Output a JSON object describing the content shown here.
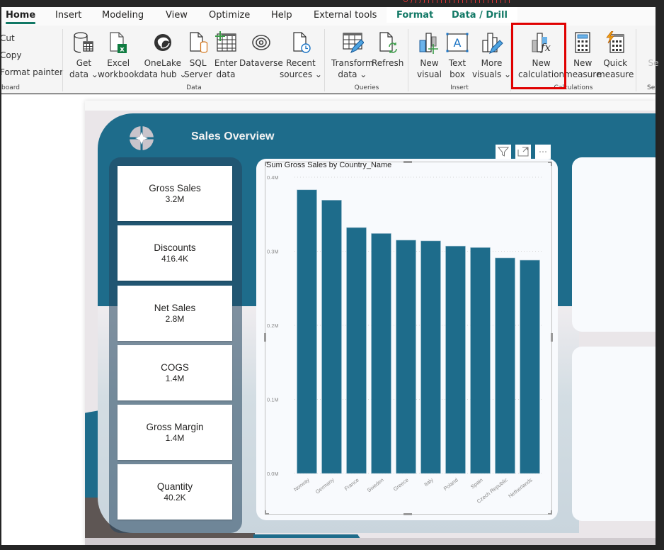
{
  "ribbon": {
    "tabs": [
      {
        "label": "Home",
        "active": true
      },
      {
        "label": "Insert"
      },
      {
        "label": "Modeling"
      },
      {
        "label": "View"
      },
      {
        "label": "Optimize"
      },
      {
        "label": "Help"
      },
      {
        "label": "External tools"
      },
      {
        "label": "Format",
        "contextual": true
      },
      {
        "label": "Data / Drill",
        "contextual": true
      }
    ],
    "clipboard": {
      "items": [
        "Cut",
        "Copy",
        "Format painter"
      ],
      "group_label": "board"
    },
    "data_group": {
      "label": "Data",
      "buttons": [
        {
          "line1": "Get",
          "line2": "data ⌄",
          "icon": "database-table-icon"
        },
        {
          "line1": "Excel",
          "line2": "workbook",
          "icon": "excel-icon"
        },
        {
          "line1": "OneLake",
          "line2": "data hub ⌄",
          "icon": "onelake-icon"
        },
        {
          "line1": "SQL",
          "line2": "Server",
          "icon": "sql-server-icon"
        },
        {
          "line1": "Enter",
          "line2": "data",
          "icon": "enter-data-icon"
        },
        {
          "line1": "Dataverse",
          "line2": "",
          "icon": "dataverse-icon"
        },
        {
          "line1": "Recent",
          "line2": "sources ⌄",
          "icon": "recent-sources-icon"
        }
      ]
    },
    "queries_group": {
      "label": "Queries",
      "buttons": [
        {
          "line1": "Transform",
          "line2": "data ⌄",
          "icon": "transform-data-icon"
        },
        {
          "line1": "Refresh",
          "line2": "",
          "icon": "refresh-icon"
        }
      ]
    },
    "insert_group": {
      "label": "Insert",
      "buttons": [
        {
          "line1": "New",
          "line2": "visual",
          "icon": "new-visual-icon"
        },
        {
          "line1": "Text",
          "line2": "box",
          "icon": "text-box-icon"
        },
        {
          "line1": "More",
          "line2": "visuals ⌄",
          "icon": "more-visuals-icon"
        }
      ]
    },
    "calculations_group": {
      "label": "Calculations",
      "buttons": [
        {
          "line1": "New",
          "line2": "calculation",
          "icon": "new-calculation-icon"
        },
        {
          "line1": "New",
          "line2": "measure",
          "icon": "new-measure-icon"
        },
        {
          "line1": "Quick",
          "line2": "measure",
          "icon": "quick-measure-icon"
        }
      ]
    },
    "truncated_group": {
      "button": "Se",
      "label": "Se"
    }
  },
  "report": {
    "title": "Sales Overview",
    "kpis": [
      {
        "name": "Gross Sales",
        "value": "3.2M"
      },
      {
        "name": "Discounts",
        "value": "416.4K"
      },
      {
        "name": "Net Sales",
        "value": "2.8M"
      },
      {
        "name": "COGS",
        "value": "1.4M"
      },
      {
        "name": "Gross Margin",
        "value": "1.4M"
      },
      {
        "name": "Quantity",
        "value": "40.2K"
      }
    ],
    "visual_header": {
      "filter": "filter-icon",
      "focus": "focus-mode-icon",
      "more": "⋯"
    },
    "colors": {
      "teal": "#1e6c8b",
      "bar": "#1e6c8b",
      "accent_green": "#117865",
      "highlight_red": "#e00000"
    }
  },
  "chart_data": {
    "type": "bar",
    "title": "Sum Gross Sales by Country_Name",
    "xlabel": "",
    "ylabel": "",
    "categories": [
      "Norway",
      "Germany",
      "France",
      "Sweden",
      "Greece",
      "Italy",
      "Poland",
      "Spain",
      "Czech Republic",
      "Netherlands"
    ],
    "values": [
      383000,
      369000,
      332000,
      324000,
      315000,
      314000,
      307000,
      305000,
      291000,
      288000
    ],
    "ylim": [
      0,
      400000
    ],
    "yticks": [
      {
        "value": 0,
        "label": "0.0M"
      },
      {
        "value": 100000,
        "label": "0.1M"
      },
      {
        "value": 200000,
        "label": "0.2M"
      },
      {
        "value": 300000,
        "label": "0.3M"
      },
      {
        "value": 400000,
        "label": "0.4M"
      }
    ],
    "grid": true,
    "legend": "none"
  }
}
